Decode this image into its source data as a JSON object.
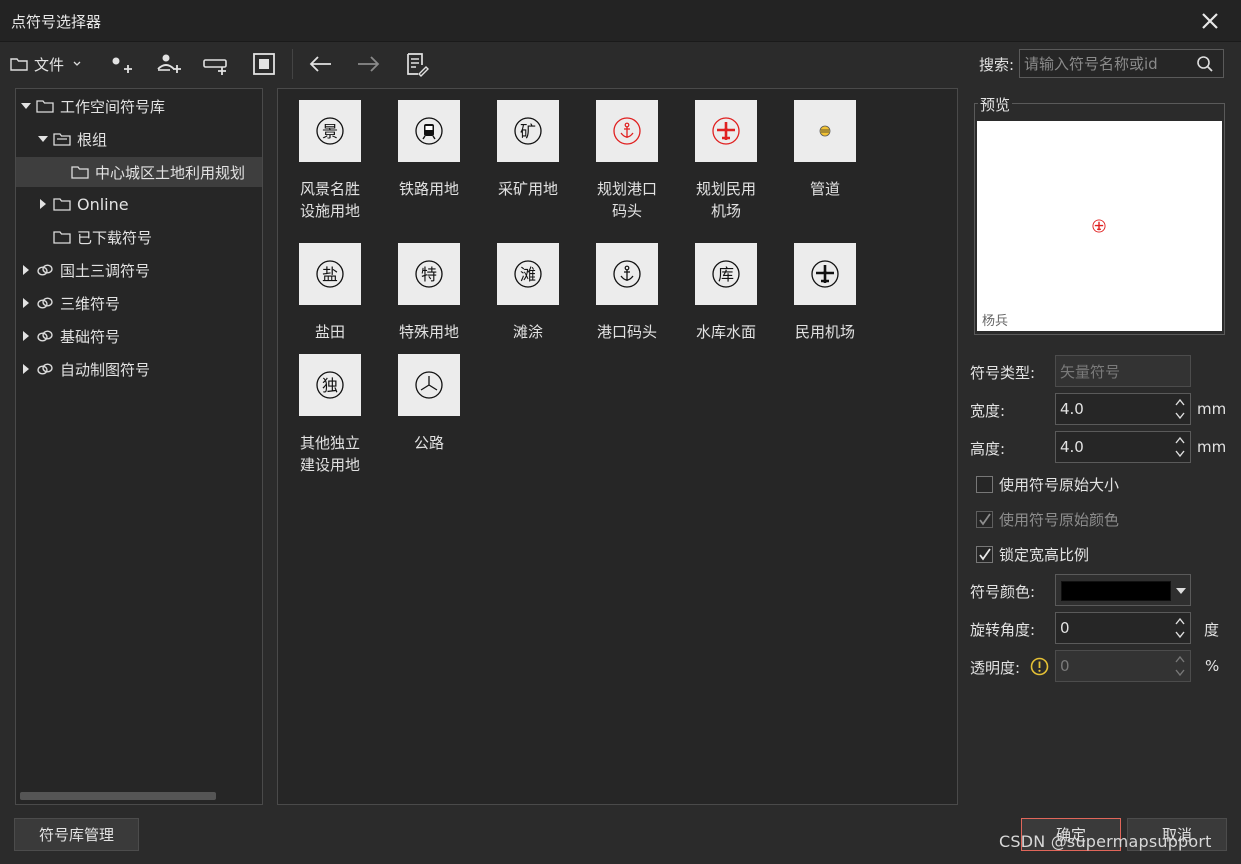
{
  "window": {
    "title": "点符号选择器"
  },
  "toolbar": {
    "file_label": "文件",
    "search_label": "搜索:",
    "search_placeholder": "请输入符号名称或id"
  },
  "tree": {
    "items": [
      {
        "label": "工作空间符号库"
      },
      {
        "label": "根组"
      },
      {
        "label": "中心城区土地利用规划"
      },
      {
        "label": "Online"
      },
      {
        "label": "已下载符号"
      },
      {
        "label": "国土三调符号"
      },
      {
        "label": "三维符号"
      },
      {
        "label": "基础符号"
      },
      {
        "label": "自动制图符号"
      }
    ]
  },
  "symbols": [
    {
      "name": "风景名胜设施用地",
      "line1": "风景名胜",
      "line2": "设施用地",
      "glyph": "景",
      "icon": "scenic-icon"
    },
    {
      "name": "铁路用地",
      "line1": "铁路用地",
      "line2": "",
      "icon": "train-icon"
    },
    {
      "name": "采矿用地",
      "line1": "采矿用地",
      "line2": "",
      "glyph": "矿",
      "icon": "mine-icon"
    },
    {
      "name": "规划港口码头",
      "line1": "规划港口",
      "line2": "码头",
      "icon": "anchor-icon",
      "color": "#e02020"
    },
    {
      "name": "规划民用机场",
      "line1": "规划民用",
      "line2": "机场",
      "icon": "airplane-icon",
      "color": "#e02020"
    },
    {
      "name": "管道",
      "line1": "管道",
      "line2": "",
      "icon": "pipeline-icon"
    },
    {
      "name": "盐田",
      "line1": "盐田",
      "line2": "",
      "glyph": "盐",
      "icon": "salt-icon"
    },
    {
      "name": "特殊用地",
      "line1": "特殊用地",
      "line2": "",
      "glyph": "特",
      "icon": "special-icon"
    },
    {
      "name": "滩涂",
      "line1": "滩涂",
      "line2": "",
      "glyph": "滩",
      "icon": "tidal-flat-icon"
    },
    {
      "name": "港口码头",
      "line1": "港口码头",
      "line2": "",
      "icon": "anchor-icon"
    },
    {
      "name": "水库水面",
      "line1": "水库水面",
      "line2": "",
      "glyph": "库",
      "icon": "reservoir-icon"
    },
    {
      "name": "民用机场",
      "line1": "民用机场",
      "line2": "",
      "icon": "airplane-icon"
    },
    {
      "name": "其他独立建设用地",
      "line1": "其他独立",
      "line2": "建设用地",
      "glyph": "独",
      "icon": "independent-icon"
    },
    {
      "name": "公路",
      "line1": "公路",
      "line2": "",
      "icon": "highway-icon"
    }
  ],
  "preview": {
    "legend": "预览",
    "caption": "杨兵"
  },
  "properties": {
    "symbol_type_label": "符号类型:",
    "symbol_type_value": "矢量符号",
    "width_label": "宽度:",
    "width_value": "4.0",
    "width_unit": "mm",
    "height_label": "高度:",
    "height_value": "4.0",
    "height_unit": "mm",
    "use_original_size": "使用符号原始大小",
    "use_original_color": "使用符号原始颜色",
    "lock_ratio": "锁定宽高比例",
    "color_label": "符号颜色:",
    "color_value": "#000000",
    "rotation_label": "旋转角度:",
    "rotation_value": "0",
    "rotation_unit": "度",
    "opacity_label": "透明度:",
    "opacity_value": "0",
    "opacity_unit": "%"
  },
  "footer": {
    "manage_label": "符号库管理",
    "ok_label": "确定",
    "cancel_label": "取消"
  },
  "watermark": "CSDN @supermapsupport"
}
